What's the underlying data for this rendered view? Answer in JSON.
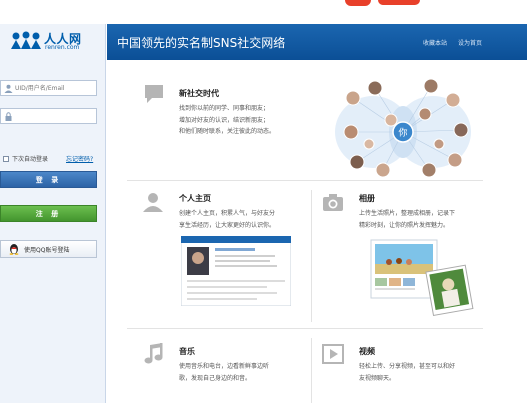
{
  "logo": {
    "name": "人人网",
    "url": "renren.com"
  },
  "login": {
    "username_placeholder": "UID/用户名/Email",
    "remember_label": "下次自动登录",
    "forgot_label": "忘记密码?",
    "login_button": "登 录",
    "register_button": "注 册",
    "qq_button": "使用QQ账号登陆"
  },
  "header": {
    "title": "中国领先的实名制SNS社交网络",
    "bookmark": "收藏本站",
    "homepage": "设为首页"
  },
  "sections": {
    "social": {
      "title": "新社交时代",
      "desc1": "找到你以前的同学、同事和朋友；",
      "desc2": "增加对好友的认识，结识新朋友；",
      "desc3": "和他们随时联系，关注彼此的动态。",
      "center_label": "你"
    },
    "profile": {
      "title": "个人主页",
      "desc1": "创建个人主页，积累人气，与好友分",
      "desc2": "享生活经历，让大家更好的认识你。"
    },
    "album": {
      "title": "相册",
      "desc1": "上传生活照片，整理成相册，记录下",
      "desc2": "精彩时刻，让你的照片发挥魅力。"
    },
    "music": {
      "title": "音乐",
      "desc1": "使用音乐和电台，边看新鲜事边听",
      "desc2": "歌，发现自己身边的和音。"
    },
    "video": {
      "title": "视频",
      "desc1": "轻松上传、分享视频，甚至可以和好",
      "desc2": "友视频聊天。"
    }
  },
  "colors": {
    "brand_blue": "#005eac",
    "header_blue": "#1b66b0",
    "login_blue": "#2d63a6",
    "register_green": "#43952e"
  }
}
